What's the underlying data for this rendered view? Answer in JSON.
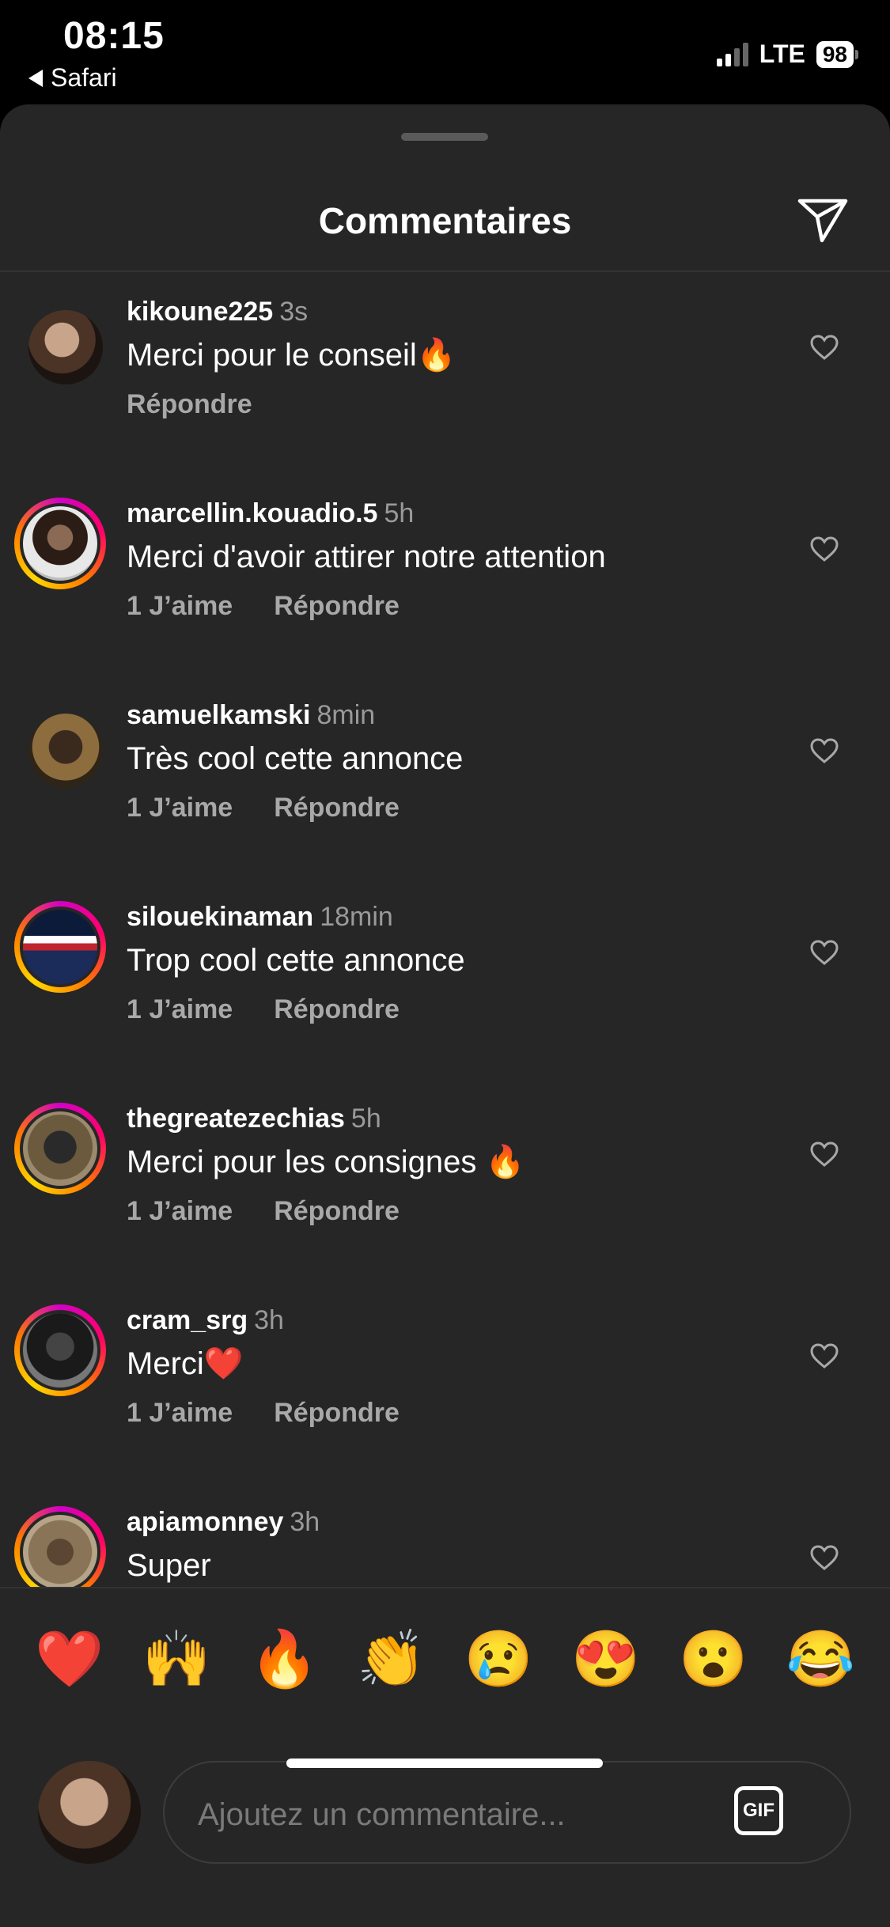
{
  "status": {
    "time": "08:15",
    "back_app": "Safari",
    "network": "LTE",
    "battery": "98"
  },
  "sheet": {
    "title": "Commentaires"
  },
  "comments": [
    {
      "username": "kikoune225",
      "time": "3s",
      "text": "Merci pour le conseil🔥",
      "likes": "",
      "reply": "Répondre"
    },
    {
      "username": "marcellin.kouadio.5",
      "time": "5h",
      "text": "Merci d'avoir attirer notre attention",
      "likes": "1 J’aime",
      "reply": "Répondre"
    },
    {
      "username": "samuelkamski",
      "time": "8min",
      "text": "Très cool cette annonce",
      "likes": "1 J’aime",
      "reply": "Répondre"
    },
    {
      "username": "silouekinaman",
      "time": "18min",
      "text": "Trop cool cette annonce",
      "likes": "1 J’aime",
      "reply": "Répondre"
    },
    {
      "username": "thegreatezechias",
      "time": "5h",
      "text": "Merci pour les consignes 🔥",
      "likes": "1 J’aime",
      "reply": "Répondre"
    },
    {
      "username": "cram_srg",
      "time": "3h",
      "text": "Merci❤️",
      "likes": "1 J’aime",
      "reply": "Répondre"
    },
    {
      "username": "apiamonney",
      "time": "3h",
      "text": "Super",
      "likes": "",
      "reply": ""
    }
  ],
  "emoji_bar": [
    "❤️",
    "🙌",
    "🔥",
    "👏",
    "😢",
    "😍",
    "😮",
    "😂"
  ],
  "input": {
    "placeholder": "Ajoutez un commentaire...",
    "gif_label": "GIF"
  },
  "colors": {
    "background": "#000000",
    "sheet": "#262626",
    "muted": "#a8a8a8"
  }
}
